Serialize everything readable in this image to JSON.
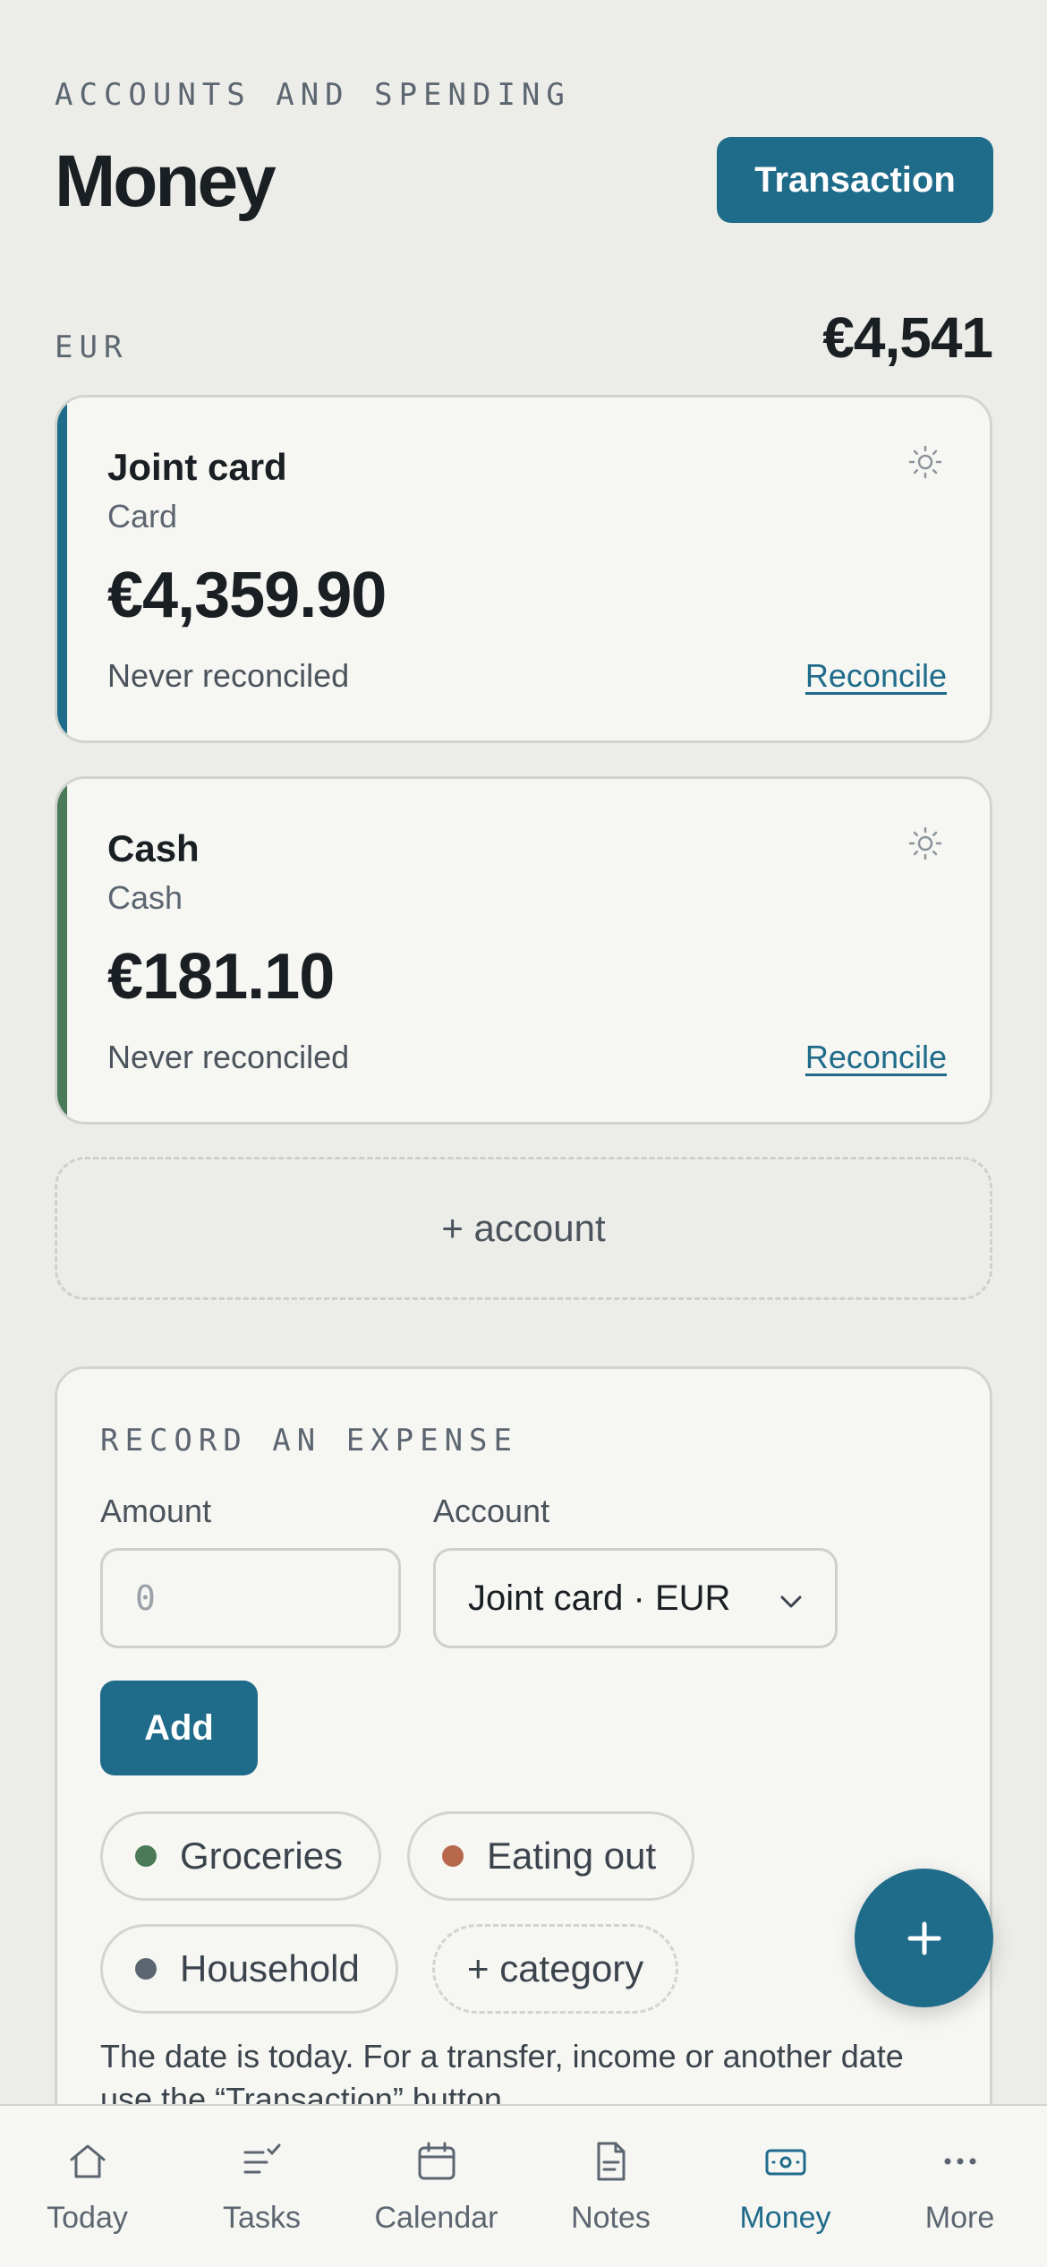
{
  "header": {
    "eyebrow": "ACCOUNTS AND SPENDING",
    "title": "Money",
    "transaction_button": "Transaction"
  },
  "currency": {
    "code": "EUR",
    "total": "€4,541"
  },
  "accounts": [
    {
      "name": "Joint card",
      "type": "Card",
      "balance": "€4,359.90",
      "status": "Never reconciled",
      "action": "Reconcile",
      "accent_color": "#1F6B8A"
    },
    {
      "name": "Cash",
      "type": "Cash",
      "balance": "€181.10",
      "status": "Never reconciled",
      "action": "Reconcile",
      "accent_color": "#4A7A57"
    }
  ],
  "add_account_label": "+ account",
  "expense": {
    "eyebrow": "RECORD AN EXPENSE",
    "amount_label": "Amount",
    "amount_placeholder": "0",
    "account_label": "Account",
    "account_selected": "Joint card · EUR",
    "add_button": "Add",
    "categories": [
      {
        "label": "Groceries",
        "color": "#4A7A57"
      },
      {
        "label": "Eating out",
        "color": "#B8684A"
      },
      {
        "label": "Household",
        "color": "#5C6670"
      }
    ],
    "add_category_label": "+ category",
    "note": "The date is today. For a transfer, income or another date use the “Transaction” button."
  },
  "fab_icon": "plus-icon",
  "tabs": [
    {
      "label": "Today",
      "icon": "home-icon",
      "active": false
    },
    {
      "label": "Tasks",
      "icon": "tasks-icon",
      "active": false
    },
    {
      "label": "Calendar",
      "icon": "calendar-icon",
      "active": false
    },
    {
      "label": "Notes",
      "icon": "notes-icon",
      "active": false
    },
    {
      "label": "Money",
      "icon": "money-icon",
      "active": true
    },
    {
      "label": "More",
      "icon": "more-icon",
      "active": false
    }
  ],
  "colors": {
    "accent": "#1F6B8A",
    "background": "#ECEDE8",
    "card": "#F6F6F3"
  }
}
